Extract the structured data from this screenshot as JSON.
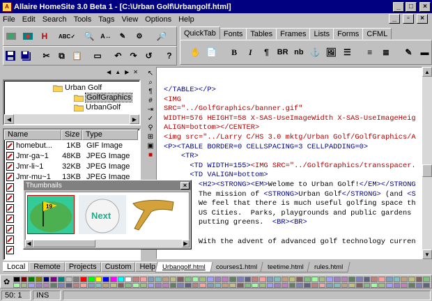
{
  "window": {
    "title": "Allaire HomeSite 3.0 Beta 1 - [C:\\Urban Golf\\Urbangolf.html]"
  },
  "menu": [
    "File",
    "Edit",
    "Search",
    "Tools",
    "Tags",
    "View",
    "Options",
    "Help"
  ],
  "quicktabs": [
    "QuickTab",
    "Fonts",
    "Tables",
    "Frames",
    "Lists",
    "Forms",
    "CFML"
  ],
  "quicktab_buttons": [
    "B",
    "I",
    "¶",
    "BR",
    "nb"
  ],
  "tree": {
    "items": [
      "Urban Golf",
      "GolfGraphics",
      "UrbanGolf"
    ]
  },
  "files": {
    "headers": [
      "Name",
      "Size",
      "Type"
    ],
    "rows": [
      {
        "name": "homebut...",
        "size": "1KB",
        "type": "GIF Image"
      },
      {
        "name": "Jmr-ga~1",
        "size": "48KB",
        "type": "JPEG Image"
      },
      {
        "name": "Jmr-li~1",
        "size": "32KB",
        "type": "JPEG Image"
      },
      {
        "name": "Jmr-mu~1",
        "size": "13KB",
        "type": "JPEG Image"
      }
    ]
  },
  "thumbnails": {
    "title": "Thumbnails",
    "ball_text": "Next",
    "flag_text": "19"
  },
  "left_tabs": [
    "Local",
    "Remote",
    "Projects",
    "Custom",
    "Help"
  ],
  "code_lines": [
    [
      [
        "b",
        "</TABLE></P>"
      ]
    ],
    [
      [
        "r",
        "<IMG"
      ]
    ],
    [
      [
        "r",
        "SRC=\"../GolfGraphics/banner.gif\""
      ]
    ],
    [
      [
        "r",
        "WIDTH=576 HEIGHT=58 X-SAS-UseImageWidth X-SAS-UseImageHeig"
      ]
    ],
    [
      [
        "r",
        "ALIGN=bottom></CENTER>"
      ]
    ],
    [
      [
        "r",
        "<img src=\"../Larry C/HS 3.0 mktg/Urban Golf/GolfGraphics/A"
      ]
    ],
    [
      [
        "b",
        "<P><TABLE BORDER=0 CELLSPACING=3 CELLPADDING=0>"
      ]
    ],
    [
      [
        "b",
        "    <TR>"
      ]
    ],
    [
      [
        "b",
        "      <TD WIDTH=155>"
      ],
      [
        "r",
        "<IMG SRC=\"../GolfGraphics/transspacer."
      ]
    ],
    [
      [
        "b",
        "      <TD VALIGN=bottom>"
      ]
    ],
    [
      [
        "b",
        "        <H2><STRONG><EM>"
      ],
      [
        "k",
        "Welome to Urban Golf!"
      ],
      [
        "b",
        "</EM></STRONG"
      ]
    ],
    [
      [
        "k",
        "        The mission of "
      ],
      [
        "b",
        "<STRONG>"
      ],
      [
        "k",
        "Urban Golf"
      ],
      [
        "b",
        "</STRONG>"
      ],
      [
        "k",
        " (and "
      ],
      [
        "b",
        "<S"
      ]
    ],
    [
      [
        "k",
        "        We feel that there is much useful golfing space th"
      ]
    ],
    [
      [
        "k",
        "        US Cities.  Parks, playgrounds and public gardens "
      ]
    ],
    [
      [
        "k",
        "        putting greens.  "
      ],
      [
        "b",
        "<BR><BR>"
      ]
    ],
    [
      [
        "k",
        ""
      ]
    ],
    [
      [
        "k",
        "        With the advent of advanced golf technology curren"
      ]
    ]
  ],
  "doc_tabs": [
    "Urbangolf.html",
    "courses1.html",
    "teetime.html",
    "rules.html"
  ],
  "status": {
    "position": "50: 1",
    "mode": "INS"
  }
}
